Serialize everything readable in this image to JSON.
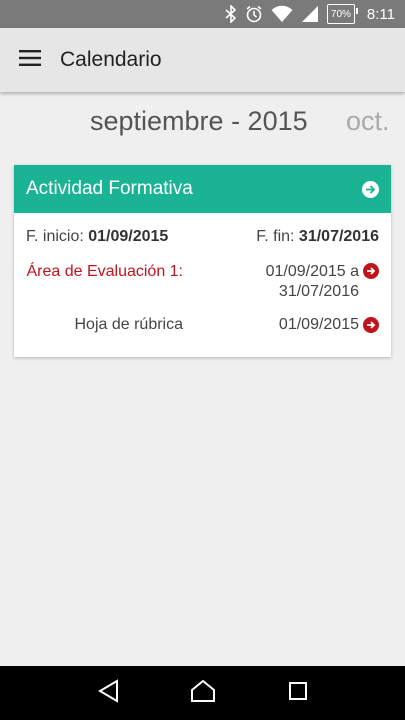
{
  "status": {
    "battery": "70%",
    "time": "8:11"
  },
  "appbar": {
    "title": "Calendario"
  },
  "month": {
    "current": "septiembre - 2015",
    "next": "oct."
  },
  "card": {
    "title": "Actividad Formativa",
    "start_label": "F. inicio:",
    "start_value": "01/09/2015",
    "end_label": "F. fin:",
    "end_value": "31/07/2016",
    "rows": [
      {
        "label": "Área de Evaluación 1:",
        "value": "01/09/2015 a 31/07/2016"
      },
      {
        "label": "Hoja de rúbrica",
        "value": "01/09/2015"
      }
    ]
  },
  "colors": {
    "accent": "#1ab394",
    "link_red": "#c0141c",
    "appbar_bg": "#e6e6e6"
  },
  "icons": [
    "bluetooth-icon",
    "alarm-icon",
    "wifi-icon",
    "signal-icon",
    "battery-icon",
    "menu-icon",
    "arrow-right-circle-icon",
    "back-icon",
    "home-icon",
    "recents-icon"
  ]
}
